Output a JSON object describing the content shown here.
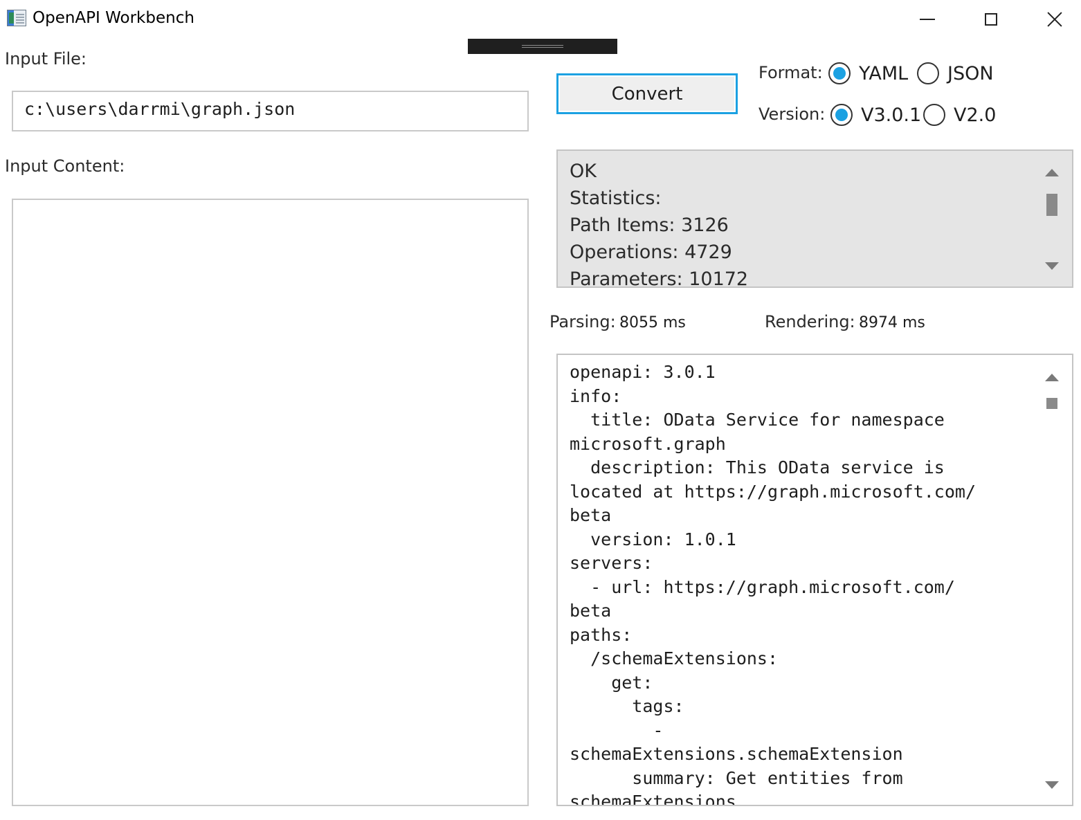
{
  "window": {
    "title": "OpenAPI Workbench",
    "controls": {
      "minimize": "minimize",
      "maximize": "maximize",
      "close": "close"
    }
  },
  "input": {
    "file_label": "Input File:",
    "file_value": "c:\\users\\darrmi\\graph.json",
    "content_label": "Input Content:",
    "content_value": ""
  },
  "toolbar": {
    "convert_label": "Convert"
  },
  "format": {
    "label": "Format:",
    "options": [
      "YAML",
      "JSON"
    ],
    "selected": "YAML"
  },
  "version": {
    "label": "Version:",
    "options": [
      "V3.0.1",
      "V2.0"
    ],
    "selected": "V3.0.1"
  },
  "status": {
    "lines": [
      "OK",
      "Statistics:",
      "Path Items: 3126",
      "Operations: 4729",
      "Parameters: 10172"
    ]
  },
  "timing": {
    "parsing_label": "Parsing:",
    "parsing_value": "8055 ms",
    "rendering_label": "Rendering:",
    "rendering_value": "8974 ms"
  },
  "output": {
    "text": "openapi: 3.0.1\ninfo:\n  title: OData Service for namespace\nmicrosoft.graph\n  description: This OData service is\nlocated at https://graph.microsoft.com/\nbeta\n  version: 1.0.1\nservers:\n  - url: https://graph.microsoft.com/\nbeta\npaths:\n  /schemaExtensions:\n    get:\n      tags:\n        -\nschemaExtensions.schemaExtension\n      summary: Get entities from\nschemaExtensions"
  },
  "colors": {
    "accent": "#1ba1e2",
    "status_bg": "#e5e5e5",
    "border": "#c4c4c4"
  }
}
